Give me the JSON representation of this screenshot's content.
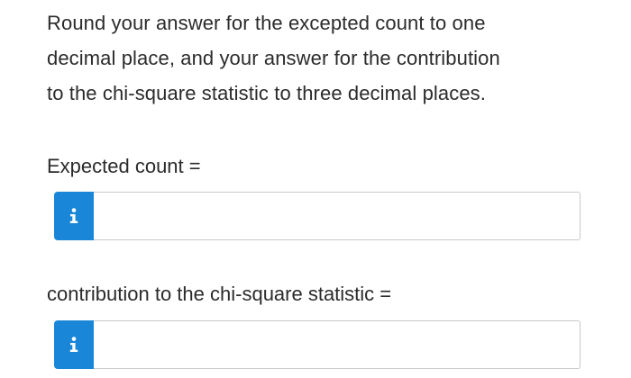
{
  "instructions": {
    "line1": "Round your answer for the excepted count to one",
    "line2": "decimal place, and your answer for the contribution",
    "line3": "to the chi-square statistic to three decimal places."
  },
  "questions": [
    {
      "label": "Expected count =",
      "value": "",
      "info_icon": "info-icon"
    },
    {
      "label": "contribution to the chi-square statistic =",
      "value": "",
      "info_icon": "info-icon"
    }
  ],
  "colors": {
    "info_button": "#1a86d7",
    "text": "#2b2b2b",
    "input_border": "#c9c9c9"
  }
}
